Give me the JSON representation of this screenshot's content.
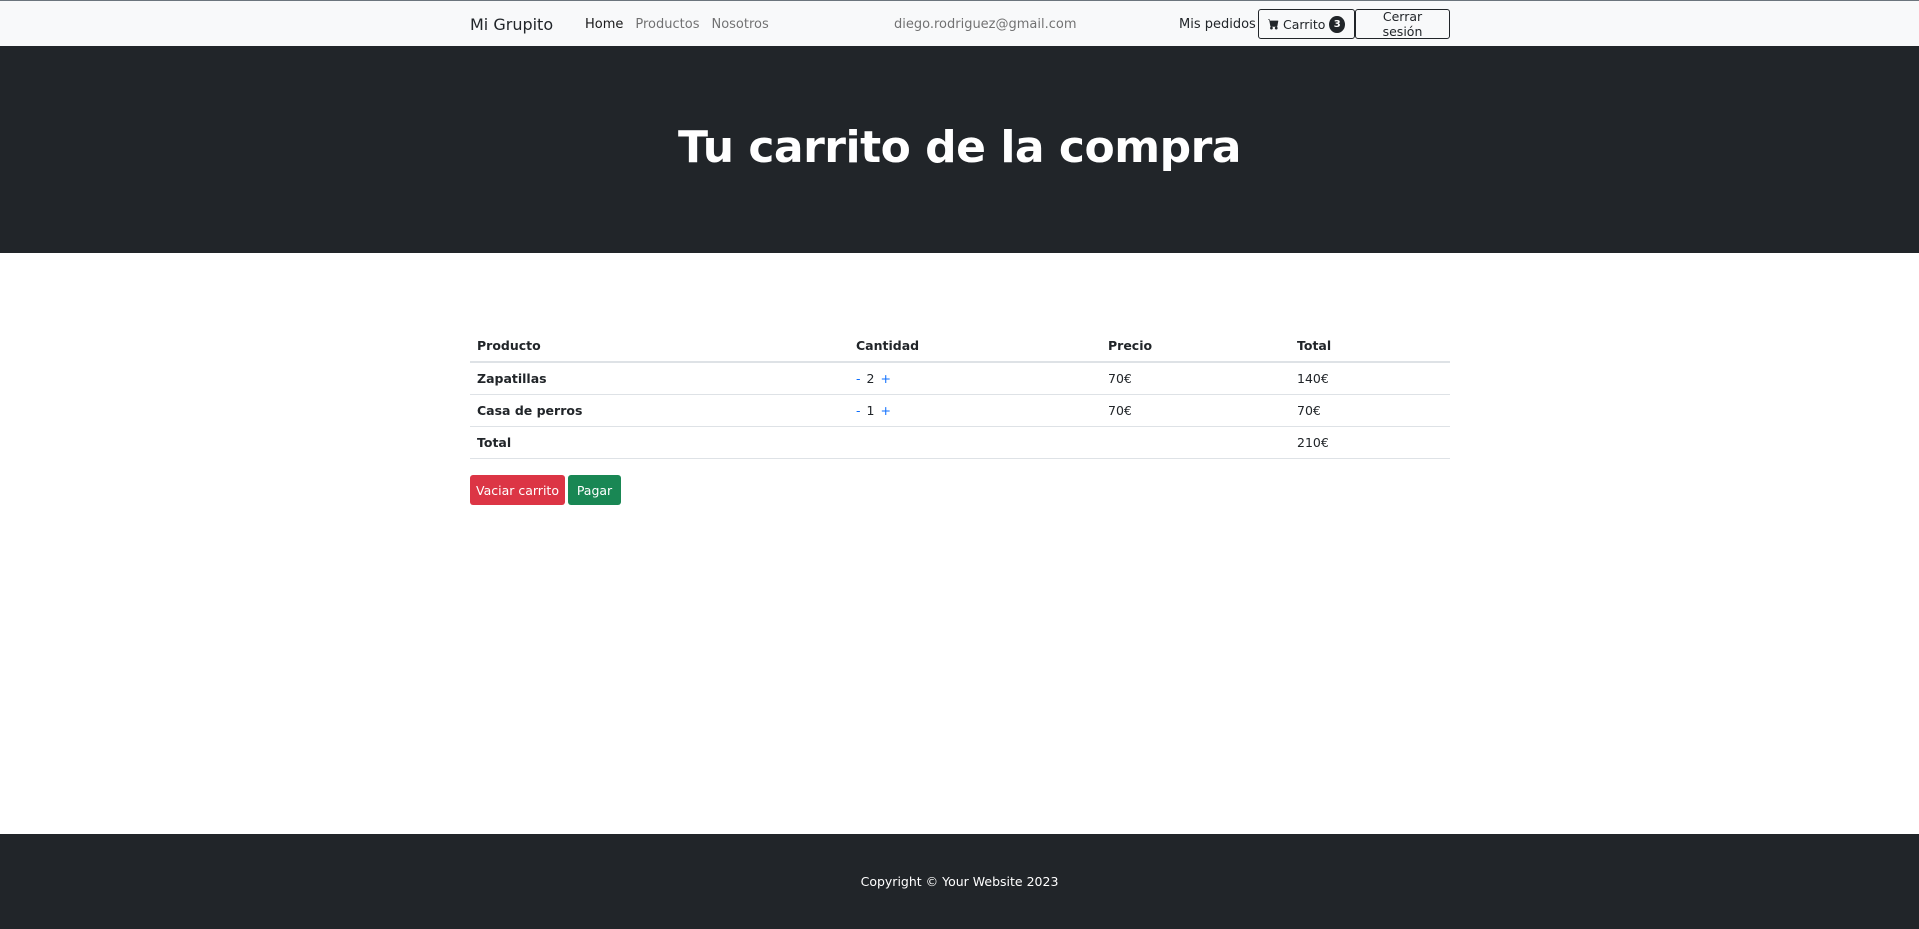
{
  "navbar": {
    "brand": "Mi Grupito",
    "links": [
      {
        "label": "Home",
        "active": true
      },
      {
        "label": "Productos",
        "active": false
      },
      {
        "label": "Nosotros",
        "active": false
      }
    ],
    "user_email": "diego.rodriguez@gmail.com",
    "orders_label": "Mis pedidos",
    "cart": {
      "label": "Carrito",
      "count": "3",
      "icon": "cart-icon"
    },
    "logout_label": "Cerrar sesión"
  },
  "hero": {
    "title": "Tu carrito de la compra"
  },
  "cart_table": {
    "headers": {
      "product": "Producto",
      "quantity": "Cantidad",
      "price": "Precio",
      "total": "Total"
    },
    "rows": [
      {
        "product": "Zapatillas",
        "decrement": "-",
        "quantity": "2",
        "increment": "+",
        "price": "70€",
        "total": "140€"
      },
      {
        "product": "Casa de perros",
        "decrement": "-",
        "quantity": "1",
        "increment": "+",
        "price": "70€",
        "total": "70€"
      }
    ],
    "footer": {
      "label": "Total",
      "total": "210€"
    }
  },
  "actions": {
    "clear_label": "Vaciar carrito",
    "pay_label": "Pagar"
  },
  "colors": {
    "dark": "#212529",
    "danger": "#dc3545",
    "success": "#198754",
    "link": "#0d6efd",
    "navbar_bg": "#f8f9fa"
  },
  "footer": {
    "copyright": "Copyright © Your Website 2023"
  }
}
